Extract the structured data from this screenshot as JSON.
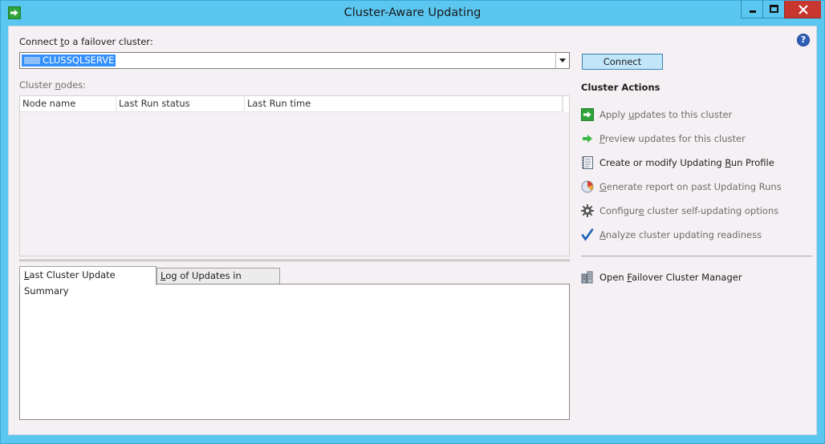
{
  "window": {
    "title": "Cluster-Aware Updating",
    "accent_color": "#5bc6ef",
    "close_color": "#c7372f"
  },
  "connect": {
    "label_prefix": "Connect ",
    "label_mnemonic": "t",
    "label_suffix": "o a failover cluster:",
    "cluster_value": "CLUSSQLSERVE",
    "connect_button": "Connect"
  },
  "grid": {
    "label_prefix": "Cluster ",
    "label_mnemonic": "n",
    "label_suffix": "odes:",
    "columns": [
      "Node name",
      "Last Run status",
      "Last Run time"
    ]
  },
  "tabs": {
    "summary_prefix": "",
    "summary_mnemonic": "L",
    "summary_suffix": "ast Cluster Update Summary",
    "log_prefix": "",
    "log_mnemonic": "L",
    "log_suffix": "og of Updates in Progress"
  },
  "actions": {
    "heading": "Cluster Actions",
    "items": [
      {
        "icon": "apply-icon",
        "pre": "Apply ",
        "mn": "u",
        "post": "pdates to this cluster",
        "enabled": false
      },
      {
        "icon": "preview-arrow-icon",
        "pre": "",
        "mn": "P",
        "post": "review updates for this cluster",
        "enabled": false
      },
      {
        "icon": "notebook-icon",
        "pre": "Create or modify Updating ",
        "mn": "R",
        "post": "un Profile",
        "enabled": true
      },
      {
        "icon": "report-icon",
        "pre": "",
        "mn": "G",
        "post": "enerate report on past Updating Runs",
        "enabled": false
      },
      {
        "icon": "gear-icon",
        "pre": "Configur",
        "mn": "e",
        "post": " cluster self-updating options",
        "enabled": false
      },
      {
        "icon": "checkmark-icon",
        "pre": "",
        "mn": "A",
        "post": "nalyze cluster updating readiness",
        "enabled": false
      }
    ],
    "manager": {
      "icon": "cluster-manager-icon",
      "pre": "Open ",
      "mn": "F",
      "post": "ailover Cluster Manager",
      "enabled": true
    }
  }
}
